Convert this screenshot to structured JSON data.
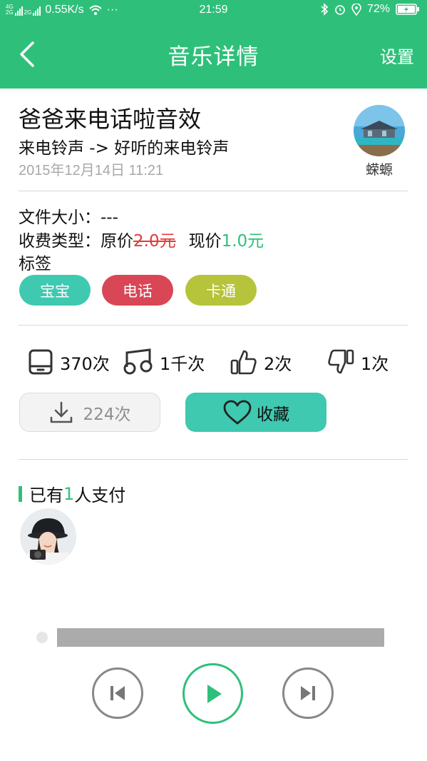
{
  "status_bar": {
    "net_speed": "0.55K/s",
    "more": "···",
    "time": "21:59",
    "battery": "72%",
    "network_tags": [
      "4G",
      "2G"
    ]
  },
  "header": {
    "title": "音乐详情",
    "settings": "设置"
  },
  "song": {
    "title": "爸爸来电话啦音效",
    "category": "来电铃声 -> 好听的来电铃声",
    "date": "2015年12月14日 11:21",
    "author": "蝾螈"
  },
  "info": {
    "size_label": "文件大小：",
    "size_value": "---",
    "fee_label": "收费类型：",
    "original_label": "原价",
    "original_price": "2.0元",
    "current_label": "现价",
    "current_price": "1.0元",
    "tags_label": "标签",
    "tags": [
      {
        "label": "宝宝",
        "color": "#3ec9b0"
      },
      {
        "label": "电话",
        "color": "#d94656"
      },
      {
        "label": "卡通",
        "color": "#b5c43a"
      }
    ]
  },
  "stats": {
    "plays": "370次",
    "listens": "1千次",
    "likes": "2次",
    "dislikes": "1次"
  },
  "actions": {
    "download_count": "224次",
    "favorite_label": "收藏"
  },
  "payers": {
    "prefix": "已有",
    "count": "1",
    "suffix": "人支付"
  },
  "player": {
    "progress": 0
  },
  "colors": {
    "brand": "#2ec07a",
    "teal": "#3ec9b0",
    "price_strike": "#e43a3a"
  },
  "icons": [
    "back-arrow-icon",
    "phone-icon",
    "headphones-icon",
    "thumbs-up-icon",
    "thumbs-down-icon",
    "download-icon",
    "heart-icon",
    "previous-icon",
    "play-icon",
    "next-icon",
    "wifi-icon",
    "bluetooth-icon",
    "alarm-icon",
    "location-icon",
    "battery-icon"
  ]
}
